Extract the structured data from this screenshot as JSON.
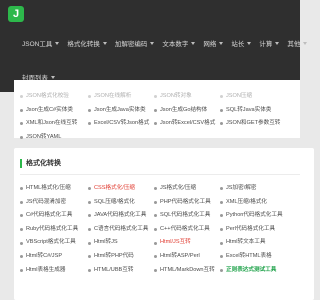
{
  "logo": {
    "text": "J"
  },
  "nav": {
    "row1": [
      {
        "label": "JSON工具",
        "caret": true
      },
      {
        "label": "格式化转换",
        "caret": true
      },
      {
        "label": "加解密编码",
        "caret": true
      },
      {
        "label": "文本数字",
        "caret": true
      },
      {
        "label": "网络",
        "caret": true
      },
      {
        "label": "站长",
        "caret": true
      },
      {
        "label": "计算",
        "caret": true
      },
      {
        "label": "其他",
        "caret": true
      }
    ],
    "row2": [
      {
        "label": "封面列表",
        "caret": true
      }
    ]
  },
  "json_tools": {
    "faded_row": [
      "JSON格式化校验",
      "JSON在线解析",
      "JSON转对象",
      "JSON压缩"
    ],
    "links": [
      "Json生成C#实体类",
      "Json生成Java实体类",
      "Json生成Go结构体",
      "SQL转Java实体类",
      "XML和Json在线互转",
      "Excel/CSV转Json格式",
      "Json转Excel/CSV格式",
      "JSON和GET参数互转",
      "JSON转YAML"
    ]
  },
  "format_section": {
    "title": "格式化转换",
    "links": [
      {
        "label": "HTML格式化/压缩",
        "style": "normal"
      },
      {
        "label": "CSS格式化/压缩",
        "style": "red"
      },
      {
        "label": "JS格式化/压缩",
        "style": "normal"
      },
      {
        "label": "JS加密/解密",
        "style": "normal"
      },
      {
        "label": "JS代码混淆加密",
        "style": "normal"
      },
      {
        "label": "SQL压缩/格式化",
        "style": "normal"
      },
      {
        "label": "PHP代码格式化工具",
        "style": "normal"
      },
      {
        "label": "XML压缩/格式化",
        "style": "normal"
      },
      {
        "label": "C#代码格式化工具",
        "style": "normal"
      },
      {
        "label": "JAVA代码格式化工具",
        "style": "normal"
      },
      {
        "label": "SQL代码格式化工具",
        "style": "normal"
      },
      {
        "label": "Python代码格式化工具",
        "style": "normal"
      },
      {
        "label": "Ruby代码格式化工具",
        "style": "normal"
      },
      {
        "label": "C语言代码格式化工具",
        "style": "normal"
      },
      {
        "label": "C++代码格式化工具",
        "style": "normal"
      },
      {
        "label": "Perl代码格式化工具",
        "style": "normal"
      },
      {
        "label": "VBScript格式化工具",
        "style": "normal"
      },
      {
        "label": "Html转JS",
        "style": "normal"
      },
      {
        "label": "Html/JS互转",
        "style": "red"
      },
      {
        "label": "Html转文本工具",
        "style": "normal"
      },
      {
        "label": "Html转C#/JSP",
        "style": "normal"
      },
      {
        "label": "Html转PHP代码",
        "style": "normal"
      },
      {
        "label": "Html转ASP/Perl",
        "style": "normal"
      },
      {
        "label": "Excel转HTML表格",
        "style": "normal"
      },
      {
        "label": "Html表格生成器",
        "style": "normal"
      },
      {
        "label": "HTML/UBB互转",
        "style": "normal"
      },
      {
        "label": "HTML/MarkDown互转",
        "style": "normal"
      },
      {
        "label": "正则表达式测试工具",
        "style": "green"
      }
    ]
  }
}
